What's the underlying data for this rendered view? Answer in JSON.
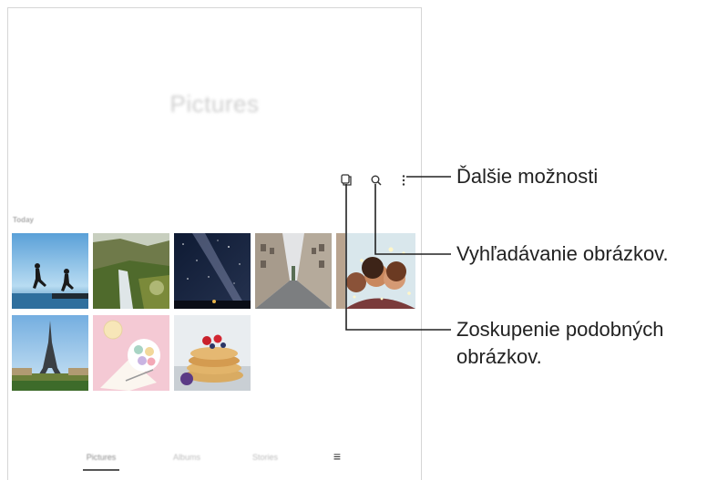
{
  "screen": {
    "title": "Pictures",
    "section_label": "Today",
    "toolbar": {
      "group_icon": "group-similar-icon",
      "search_icon": "search-icon",
      "more_icon": "more-options-icon"
    },
    "thumbnails": [
      {
        "name": "jumping-people"
      },
      {
        "name": "waterfall-landscape"
      },
      {
        "name": "milky-way-night"
      },
      {
        "name": "city-street"
      },
      {
        "name": "sparkler-friends"
      },
      {
        "name": "eiffel-tower"
      },
      {
        "name": "macarons"
      },
      {
        "name": "pancakes"
      }
    ],
    "bottom_nav": {
      "tabs": [
        "Pictures",
        "Albums",
        "Stories"
      ],
      "active_tab": "Pictures",
      "menu_icon": "menu-icon"
    }
  },
  "callouts": {
    "more_options": "Ďalšie možnosti",
    "search": "Vyhľadávanie obrázkov.",
    "group_line1": "Zoskupenie podobných",
    "group_line2": "obrázkov."
  }
}
